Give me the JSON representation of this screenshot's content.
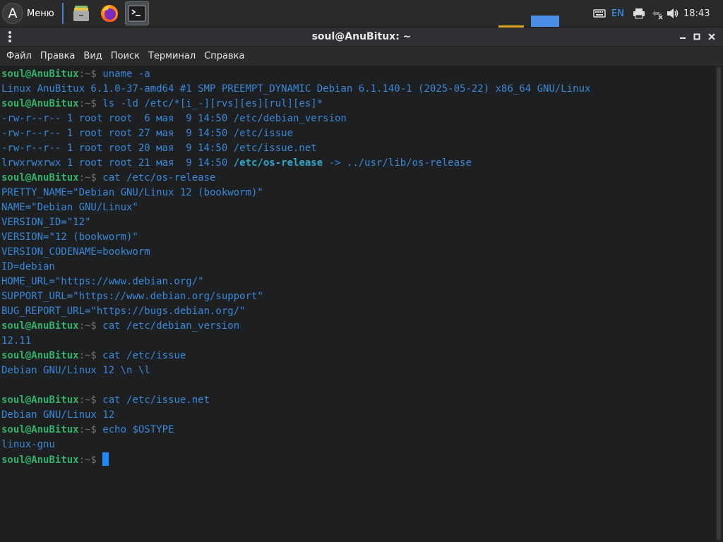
{
  "panel": {
    "menu_label": "Меню",
    "logo_glyph": "A",
    "lang": "EN",
    "clock": "18:43"
  },
  "window": {
    "title": "soul@AnuBitux: ~"
  },
  "menubar": {
    "items": [
      "Файл",
      "Правка",
      "Вид",
      "Поиск",
      "Терминал",
      "Справка"
    ]
  },
  "terminal": {
    "user_host": "soul@AnuBitux",
    "path_prompt": ":~$ ",
    "lines": [
      {
        "t": "prompt",
        "cmd": "uname -a"
      },
      {
        "t": "out",
        "text": "Linux AnuBitux 6.1.0-37-amd64 #1 SMP PREEMPT_DYNAMIC Debian 6.1.140-1 (2025-05-22) x86_64 GNU/Linux"
      },
      {
        "t": "prompt",
        "cmd": "ls -ld /etc/*[i_-][rvs][es][rul][es]*"
      },
      {
        "t": "out",
        "text": "-rw-r--r-- 1 root root  6 мая  9 14:50 /etc/debian_version"
      },
      {
        "t": "out",
        "text": "-rw-r--r-- 1 root root 27 мая  9 14:50 /etc/issue"
      },
      {
        "t": "out",
        "text": "-rw-r--r-- 1 root root 20 мая  9 14:50 /etc/issue.net"
      },
      {
        "t": "link",
        "pre": "lrwxrwxrwx 1 root root 21 мая  9 14:50 ",
        "name": "/etc/os-release",
        "post": " -> ../usr/lib/os-release"
      },
      {
        "t": "prompt",
        "cmd": "cat /etc/os-release"
      },
      {
        "t": "out",
        "text": "PRETTY_NAME=\"Debian GNU/Linux 12 (bookworm)\""
      },
      {
        "t": "out",
        "text": "NAME=\"Debian GNU/Linux\""
      },
      {
        "t": "out",
        "text": "VERSION_ID=\"12\""
      },
      {
        "t": "out",
        "text": "VERSION=\"12 (bookworm)\""
      },
      {
        "t": "out",
        "text": "VERSION_CODENAME=bookworm"
      },
      {
        "t": "out",
        "text": "ID=debian"
      },
      {
        "t": "out",
        "text": "HOME_URL=\"https://www.debian.org/\""
      },
      {
        "t": "out",
        "text": "SUPPORT_URL=\"https://www.debian.org/support\""
      },
      {
        "t": "out",
        "text": "BUG_REPORT_URL=\"https://bugs.debian.org/\""
      },
      {
        "t": "prompt",
        "cmd": "cat /etc/debian_version"
      },
      {
        "t": "out",
        "text": "12.11"
      },
      {
        "t": "prompt",
        "cmd": "cat /etc/issue"
      },
      {
        "t": "out",
        "text": "Debian GNU/Linux 12 \\n \\l"
      },
      {
        "t": "out",
        "text": ""
      },
      {
        "t": "prompt",
        "cmd": "cat /etc/issue.net"
      },
      {
        "t": "out",
        "text": "Debian GNU/Linux 12"
      },
      {
        "t": "prompt",
        "cmd": "echo $OSTYPE"
      },
      {
        "t": "out",
        "text": "linux-gnu"
      },
      {
        "t": "cursor",
        "cmd": ""
      }
    ]
  },
  "colors": {
    "prompt_user": "#33b06a",
    "output_text": "#3a88d8",
    "symlink": "#2fa7c9",
    "cursor": "#1e88ff",
    "background": "#1d1f21"
  },
  "icons": [
    "anubitux-logo-icon",
    "file-manager-icon",
    "firefox-icon",
    "terminal-icon",
    "keyboard-icon",
    "printer-icon",
    "network-icon",
    "volume-icon",
    "window-menu-icon",
    "minimize-icon",
    "maximize-icon",
    "close-icon"
  ]
}
